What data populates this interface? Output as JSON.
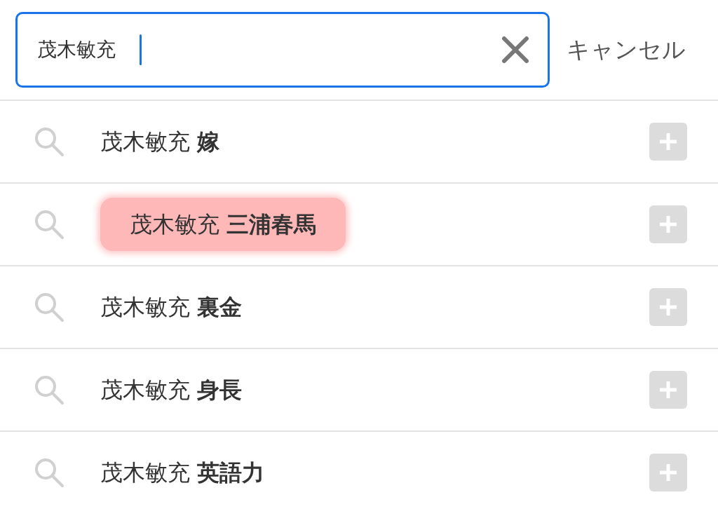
{
  "search": {
    "value": "茂木敏充",
    "cancel": "キャンセル"
  },
  "suggestions": [
    {
      "text": "茂木敏充 **嫁**",
      "highlighted": false
    },
    {
      "text": "茂木敏充 **三浦春馬**",
      "highlighted": true
    },
    {
      "text": "茂木敏充 **裏金**",
      "highlighted": false
    },
    {
      "text": "茂木敏充 **身長**",
      "highlighted": false
    },
    {
      "text": "茂木敏充 **英語力**",
      "highlighted": false
    }
  ]
}
